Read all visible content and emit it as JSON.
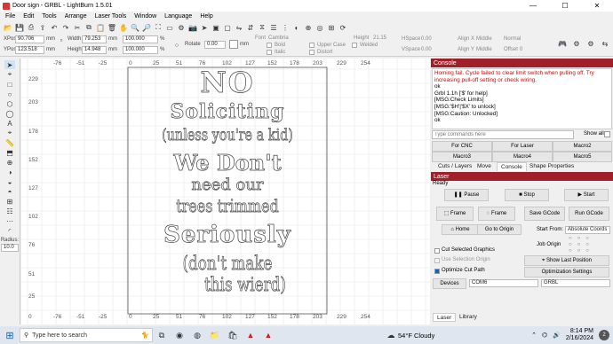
{
  "window": {
    "title": "Door sign - GRBL - LightBurn 1.5.01",
    "minimize": "—",
    "maximize": "☐",
    "close": "✕"
  },
  "menu": [
    "File",
    "Edit",
    "Tools",
    "Arrange",
    "Laser Tools",
    "Window",
    "Language",
    "Help"
  ],
  "toolbar": {
    "xpos_label": "XPos",
    "xpos": "90.706",
    "ypos_label": "YPos",
    "ypos": "123.518",
    "unit_mm": "mm",
    "width_label": "Width",
    "width": "79.253",
    "height_label": "Height",
    "height": "14.948",
    "scale_w": "100.000",
    "scale_h": "100.000",
    "pct": "%",
    "rotate_label": "Rotate",
    "rotate": "0.00",
    "rotate_unit": "mm",
    "font_label": "Font",
    "font": "Cambria",
    "height2_label": "Height",
    "height2": "21.15",
    "bold": "Bold",
    "italic": "Italic",
    "upper_case": "Upper Case",
    "welded": "Welded",
    "distort": "Distort",
    "hspace_label": "HSpace",
    "hspace": "0.00",
    "vspace_label": "VSpace",
    "vspace": "0.00",
    "align_x_label": "Align X",
    "align_x": "Middle",
    "align_y_label": "Align Y",
    "align_y": "Middle",
    "normal": "Normal",
    "offset_label": "Offset",
    "offset": "0"
  },
  "ruler": {
    "x": [
      "-76",
      "-51",
      "-25",
      "0",
      "25",
      "51",
      "76",
      "102",
      "127",
      "152",
      "178",
      "203",
      "229",
      "254"
    ],
    "y": [
      "229",
      "203",
      "178",
      "152",
      "127",
      "102",
      "76",
      "51",
      "25",
      "0"
    ],
    "bottom_x": [
      "-76",
      "-51",
      "-25",
      "0",
      "25",
      "51",
      "76",
      "102",
      "127",
      "152",
      "178",
      "203",
      "229",
      "254"
    ]
  },
  "sign_lines": [
    "NO",
    "Soliciting",
    "(unless you're a kid)",
    "We Don't",
    "need our",
    "trees trimmed",
    "Seriously",
    "(don't make",
    "this wierd)"
  ],
  "left_tools": {
    "radius_label": "Radius:",
    "radius": "10.0"
  },
  "console": {
    "header": "Console",
    "error": "Homing fail. Cycle failed to clear limit switch when pulling off. Try increasing pull-off setting or check wiring.",
    "lines": [
      "ok",
      "Grbl 1.1h ['$' for help]",
      "[MSG:Check Limits]",
      "[MSG:'$H'|'$X' to unlock]",
      "[MSG:Caution: Unlocked]",
      "ok"
    ],
    "command_placeholder": "Type commands here",
    "show_all": "Show all",
    "macros": [
      "For CNC",
      "For Laser",
      "Macro2",
      "Macro3",
      "Macro4",
      "Macro5"
    ]
  },
  "tabs": [
    "Cuts / Layers",
    "Move",
    "Console",
    "Shape Properties"
  ],
  "laser": {
    "header": "Laser",
    "status": "Ready",
    "pause": "Pause",
    "stop": "Stop",
    "start": "Start",
    "frame1": "Frame",
    "frame2": "Frame",
    "save_gcode": "Save GCode",
    "run_gcode": "Run GCode",
    "home": "Home",
    "go_to_origin": "Go to Origin",
    "start_from_label": "Start From:",
    "start_from": "Absolute Coords",
    "job_origin_label": "Job Origin",
    "cut_selected": "Cut Selected Graphics",
    "use_selection_origin": "Use Selection Origin",
    "show_last_position": "Show Last Position",
    "optimize_cut_path": "Optimize Cut Path",
    "optimization_settings": "Optimization Settings",
    "devices": "Devices",
    "port": "COM6",
    "device": "GRBL"
  },
  "bottom_tabs": [
    "Laser",
    "Library"
  ],
  "taskbar": {
    "search_placeholder": "Type here to search",
    "weather": "54°F Cloudy",
    "time": "8:14 PM",
    "date": "2/16/2024",
    "notifications": "2"
  }
}
